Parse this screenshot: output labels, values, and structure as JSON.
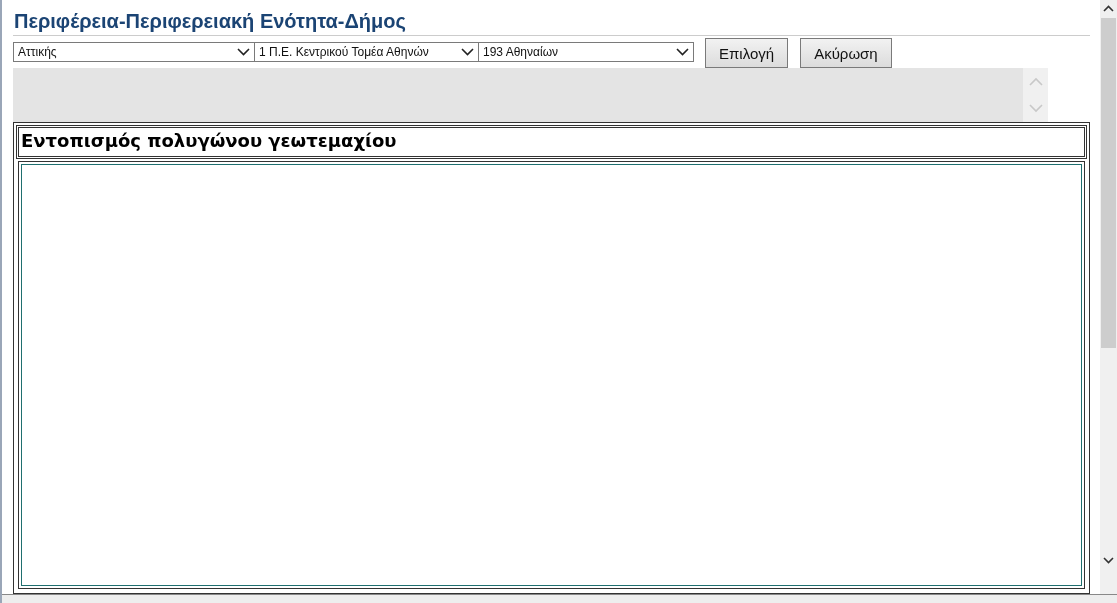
{
  "page_title": "Περιφέρεια-Περιφερειακή Ενότητα-Δήμος",
  "selects": [
    {
      "value": "Αττικής"
    },
    {
      "value": "1 Π.Ε. Κεντρικού Τομέα Αθηνών"
    },
    {
      "value": "193 Αθηναίων"
    }
  ],
  "buttons": [
    "Επιλογή",
    "Ακύρωση"
  ],
  "panel": {
    "title": "Εντοπισμός πολυγώνου γεωτεμαχίου"
  }
}
